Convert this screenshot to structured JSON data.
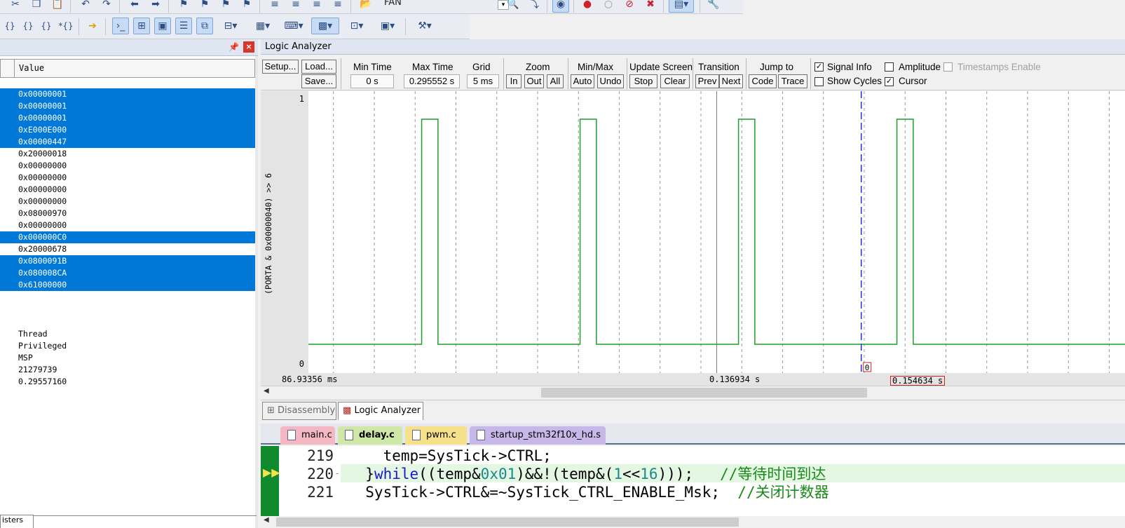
{
  "toolbar": {
    "target_name": "FAN",
    "row2_icons": [
      "step-into-icon",
      "step-over-icon",
      "step-out-icon",
      "run-to-cursor-icon",
      "show-next-statement-icon",
      "command-window-icon",
      "disassembly-window-icon",
      "symbols-window-icon",
      "registers-window-icon",
      "call-stack-icon",
      "watch-windows-icon",
      "memory-windows-icon",
      "serial-windows-icon",
      "analysis-windows-icon",
      "trace-windows-icon",
      "system-viewer-icon",
      "toolbox-icon"
    ]
  },
  "watch_panel": {
    "column_value": "Value",
    "values": [
      {
        "text": "0x00000001",
        "selected": true
      },
      {
        "text": "0x00000001",
        "selected": true
      },
      {
        "text": "0x00000001",
        "selected": true
      },
      {
        "text": "0xE000E000",
        "selected": true
      },
      {
        "text": "0x00000447",
        "selected": true
      },
      {
        "text": "0x20000018",
        "selected": false
      },
      {
        "text": "0x00000000",
        "selected": false
      },
      {
        "text": "0x00000000",
        "selected": false
      },
      {
        "text": "0x00000000",
        "selected": false
      },
      {
        "text": "0x00000000",
        "selected": false
      },
      {
        "text": "0x08000970",
        "selected": false
      },
      {
        "text": "0x00000000",
        "selected": false
      },
      {
        "text": "0x000000C0",
        "selected": true
      },
      {
        "text": "0x20000678",
        "selected": false
      },
      {
        "text": "0x0800091B",
        "selected": true
      },
      {
        "text": "0x080008CA",
        "selected": true
      },
      {
        "text": "0x61000000",
        "selected": true
      }
    ],
    "system": [
      "Thread",
      "Privileged",
      "MSP",
      "21279739",
      "0.29557160"
    ],
    "bottom_tab": "isters"
  },
  "logic_analyzer": {
    "title": "Logic Analyzer",
    "setup": "Setup...",
    "load": "Load...",
    "save": "Save...",
    "min_time_label": "Min Time",
    "min_time": "0 s",
    "max_time_label": "Max Time",
    "max_time": "0.295552 s",
    "grid_label": "Grid",
    "grid": "5 ms",
    "zoom_label": "Zoom",
    "zoom_in": "In",
    "zoom_out": "Out",
    "zoom_all": "All",
    "minmax_label": "Min/Max",
    "auto": "Auto",
    "undo": "Undo",
    "update_label": "Update Screen",
    "stop": "Stop",
    "clear": "Clear",
    "transition_label": "Transition",
    "prev": "Prev",
    "next": "Next",
    "jump_label": "Jump to",
    "code": "Code",
    "trace": "Trace",
    "signal_info": "Signal Info",
    "show_cycles": "Show Cycles",
    "amplitude": "Amplitude",
    "cursor": "Cursor",
    "timestamps": "Timestamps Enable",
    "signal_info_checked": true,
    "show_cycles_checked": false,
    "amplitude_checked": false,
    "cursor_checked": true,
    "timestamps_checked": false,
    "signal_name": "(PORTA & 0x00000040) >> 6",
    "y_max": "1",
    "y_min": "0",
    "time_left": "86.93356 ms",
    "time_center": "0.136934 s",
    "cursor_time": "0.154634 s",
    "cursor_value": "0"
  },
  "chart_data": {
    "type": "line",
    "title": "",
    "xlabel": "",
    "ylabel": "(PORTA & 0x00000040) >> 6",
    "ylim": [
      0,
      1
    ],
    "xlim_ms": [
      86.93356,
      186.93
    ],
    "grid": true,
    "series": [
      {
        "name": "(PORTA & 0x00000040) >> 6",
        "pulses_ms": [
          [
            100.8,
            102.8
          ],
          [
            120.2,
            122.2
          ],
          [
            139.6,
            141.6
          ],
          [
            159.0,
            161.0
          ]
        ]
      }
    ],
    "cursor_ms": 154.634
  },
  "bottom_tabs": [
    "Disassembly",
    "Logic Analyzer"
  ],
  "file_tabs": [
    {
      "name": "main.c",
      "color": "#f4b7c4"
    },
    {
      "name": "delay.c",
      "color": "#cfe8a8"
    },
    {
      "name": "pwm.c",
      "color": "#f6e08a"
    },
    {
      "name": "startup_stm32f10x_hd.s",
      "color": "#c8b8ea"
    }
  ],
  "code": {
    "lines": [
      {
        "num": "219",
        "text": "    temp=SysTick->CTRL;"
      },
      {
        "num": "220",
        "text": "  }while((temp&0x01)&&!(temp&(1<<16)));   //等待时间到达"
      },
      {
        "num": "221",
        "text": "  SysTick->CTRL&=~SysTick_CTRL_ENABLE_Msk;  //关闭计数器"
      }
    ]
  }
}
